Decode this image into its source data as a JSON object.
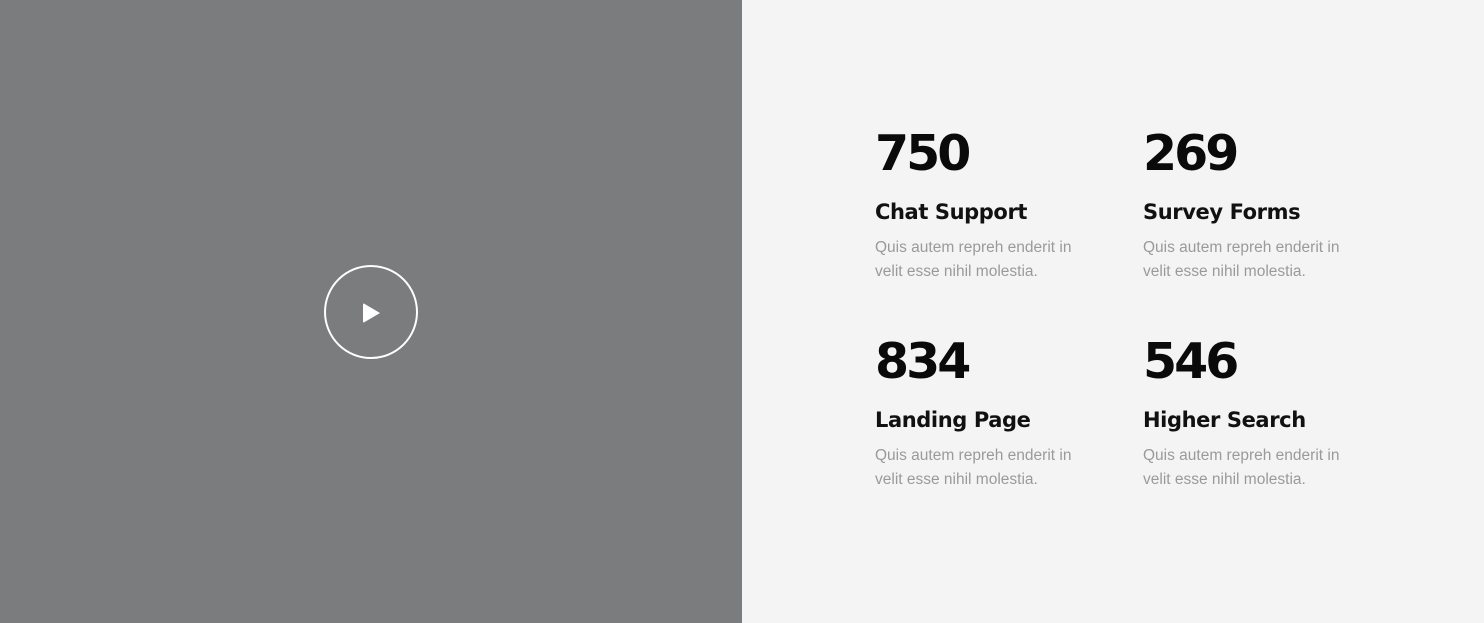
{
  "video": {
    "play_icon": "play-icon"
  },
  "stats": [
    {
      "number": "750",
      "title": "Chat Support",
      "description": "Quis autem repreh enderit in velit esse nihil molestia."
    },
    {
      "number": "269",
      "title": "Survey Forms",
      "description": "Quis autem repreh enderit in velit esse nihil molestia."
    },
    {
      "number": "834",
      "title": "Landing Page",
      "description": "Quis autem repreh enderit in velit esse nihil molestia."
    },
    {
      "number": "546",
      "title": "Higher Search",
      "description": "Quis autem repreh enderit in velit esse nihil molestia."
    }
  ],
  "colors": {
    "video_bg": "#7b7c7e",
    "stats_bg": "#f4f4f4",
    "number": "#0a0a0a",
    "description": "#9a9a9a"
  }
}
